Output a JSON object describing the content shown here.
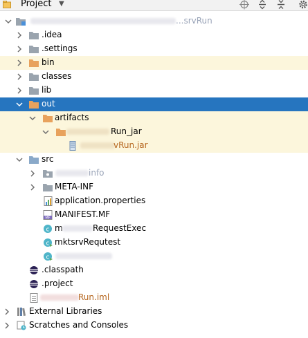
{
  "header": {
    "title": "Project",
    "dropdown_icon": "chevron-down-icon",
    "toolbar": [
      "crosshair-icon",
      "expand-all-icon",
      "collapse-all-icon",
      "gear-icon"
    ]
  },
  "tree": {
    "root_suffix": "...srvRun",
    "idea": ".idea",
    "settings": ".settings",
    "bin": "bin",
    "classes": "classes",
    "lib": "lib",
    "out": "out",
    "artifacts": "artifacts",
    "artifact_jar_dir_suffix": "Run_jar",
    "artifact_jar_suffix": "vRun.jar",
    "src": "src",
    "src_child_suffix": "info",
    "meta_inf": "META-INF",
    "app_props": "application.properties",
    "manifest": "MANIFEST.MF",
    "class1_prefix": "m",
    "class1_suffix": "RequestExec",
    "class2": "mktsrvRequtest",
    "classpath": ".classpath",
    "project_file": ".project",
    "iml_suffix": "Run.iml",
    "external_libraries": "External Libraries",
    "scratches": "Scratches and Consoles"
  },
  "colors": {
    "selection": "#2675bf",
    "highlight_row": "#fcf6dc",
    "folder_gray": "#9aa4ae",
    "folder_orange": "#e8a25d",
    "folder_blue": "#8aa9c9"
  }
}
